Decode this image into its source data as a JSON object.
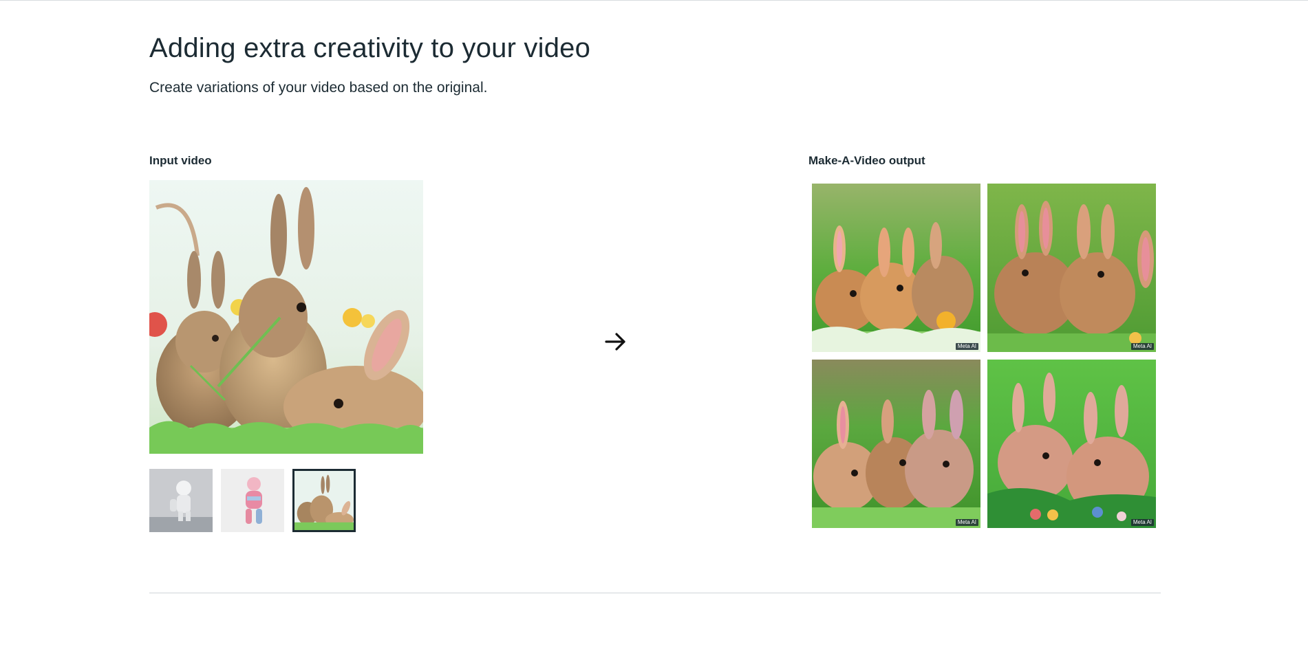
{
  "section": {
    "title": "Adding extra creativity to your video",
    "subtitle": "Create variations of your video based on the original."
  },
  "input": {
    "label": "Input video",
    "thumbnails": [
      {
        "name": "astronaut",
        "selected": false
      },
      {
        "name": "knitted-figure",
        "selected": false
      },
      {
        "name": "bunnies",
        "selected": true
      }
    ]
  },
  "transform_icon": "arrow-right-icon",
  "output": {
    "label": "Make-A-Video output",
    "watermark": "Meta AI",
    "cells": 4
  },
  "colors": {
    "text": "#1c2b33",
    "selected_border": "#1c2b33",
    "divider": "#cfd4d8"
  }
}
